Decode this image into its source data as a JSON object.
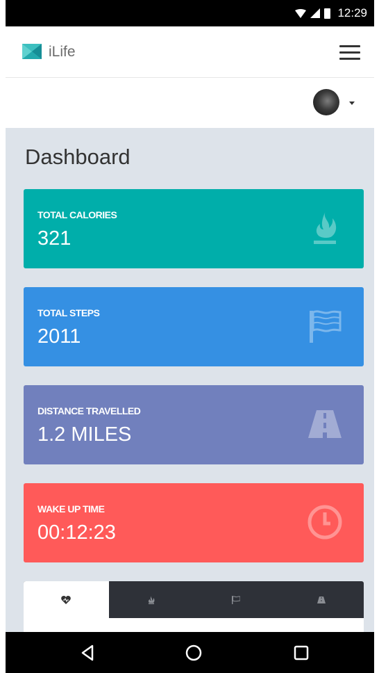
{
  "status_bar": {
    "time": "12:29"
  },
  "app": {
    "title": "iLife"
  },
  "page": {
    "title": "Dashboard"
  },
  "cards": [
    {
      "label": "TOTAL CALORIES",
      "value": "321",
      "color": "#00aeaa",
      "icon": "flame-icon"
    },
    {
      "label": "TOTAL STEPS",
      "value": "2011",
      "color": "#3590e3",
      "icon": "flag-icon"
    },
    {
      "label": "DISTANCE TRAVELLED",
      "value": "1.2 MILES",
      "color": "#7180bd",
      "icon": "road-icon"
    },
    {
      "label": "WAKE UP TIME",
      "value": "00:12:23",
      "color": "#ff5a59",
      "icon": "clock-icon"
    }
  ],
  "tabs": [
    {
      "icon": "heart-icon",
      "active": true
    },
    {
      "icon": "flame-icon",
      "active": false
    },
    {
      "icon": "flag-icon",
      "active": false
    },
    {
      "icon": "road-icon",
      "active": false
    }
  ],
  "colors": {
    "content_bg": "#dde3ea",
    "tabbar_bg": "#2e3138",
    "accent_logo": "#1fa3a8"
  }
}
